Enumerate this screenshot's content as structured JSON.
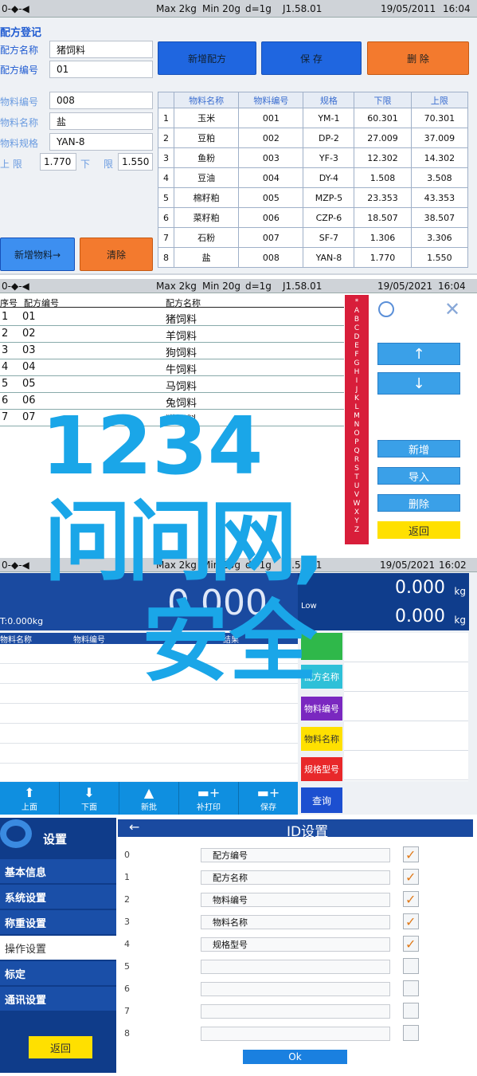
{
  "panel1": {
    "status": {
      "left": "0-◆-◀",
      "max": "Max 2kg",
      "min": "Min 20g",
      "d": "d=1g",
      "ver": "J1.58.01",
      "date": "19/05/2011",
      "time": "16:04"
    },
    "title": "配方登记",
    "recipe_name_label": "配方名称",
    "recipe_name_value": "猪饲料",
    "recipe_code_label": "配方编号",
    "recipe_code_value": "01",
    "btn_new_recipe": "新增配方",
    "btn_save": "保    存",
    "btn_delete": "删    除",
    "mat_code_label": "物料编号",
    "mat_code_value": "008",
    "mat_name_label": "物料名称",
    "mat_name_value": "盐",
    "mat_spec_label": "物料规格",
    "mat_spec_value": "YAN-8",
    "upper_label": "上    限",
    "upper_value": "1.770",
    "lower_label": "下",
    "limit_label": "限",
    "lower_value": "1.550",
    "btn_add_material": "新增物料→",
    "btn_clear": "清除",
    "table_headers": [
      "",
      "物料名称",
      "物料编号",
      "规格",
      "下限",
      "上限"
    ],
    "table_rows": [
      [
        "1",
        "玉米",
        "001",
        "YM-1",
        "60.301",
        "70.301"
      ],
      [
        "2",
        "豆粕",
        "002",
        "DP-2",
        "27.009",
        "37.009"
      ],
      [
        "3",
        "鱼粉",
        "003",
        "YF-3",
        "12.302",
        "14.302"
      ],
      [
        "4",
        "豆油",
        "004",
        "DY-4",
        "1.508",
        "3.508"
      ],
      [
        "5",
        "棉籽粕",
        "005",
        "MZP-5",
        "23.353",
        "43.353"
      ],
      [
        "6",
        "菜籽粕",
        "006",
        "CZP-6",
        "18.507",
        "38.507"
      ],
      [
        "7",
        "石粉",
        "007",
        "SF-7",
        "1.306",
        "3.306"
      ],
      [
        "8",
        "盐",
        "008",
        "YAN-8",
        "1.770",
        "1.550"
      ]
    ]
  },
  "panel2": {
    "status": {
      "left": "0-◆-◀",
      "max": "Max 2kg",
      "min": "Min 20g",
      "d": "d=1g",
      "ver": "J1.58.01",
      "date": "19/05/2021",
      "time": "16:04"
    },
    "col_seq": "序号",
    "col_code": "配方编号",
    "col_name": "配方名称",
    "rows": [
      [
        "1",
        "01",
        "猪饲料"
      ],
      [
        "2",
        "02",
        "羊饲料"
      ],
      [
        "3",
        "03",
        "狗饲料"
      ],
      [
        "4",
        "04",
        "牛饲料"
      ],
      [
        "5",
        "05",
        "马饲料"
      ],
      [
        "6",
        "06",
        "兔饲料"
      ],
      [
        "7",
        "07",
        "猫饲料"
      ]
    ],
    "alphabet": [
      "*",
      "A",
      "B",
      "C",
      "D",
      "E",
      "F",
      "G",
      "H",
      "I",
      "J",
      "K",
      "L",
      "M",
      "N",
      "O",
      "P",
      "Q",
      "R",
      "S",
      "T",
      "U",
      "V",
      "W",
      "X",
      "Y",
      "Z"
    ],
    "btn_up": "↑",
    "btn_down": "↓",
    "btn_add": "新增",
    "btn_import": "导入",
    "btn_delete": "删除",
    "btn_back": "返回"
  },
  "watermark": {
    "line1": "1234",
    "line2": "问问网,",
    "line3": "安全"
  },
  "panel3": {
    "status": {
      "left": "0-◆-◀",
      "max": "Max 2kg",
      "min": "Min 20g",
      "d": "d=1g",
      "ver": "J1.58.01",
      "date": "19/05/2021",
      "time": "16:02"
    },
    "big_weight": "0.000",
    "weight_hi": "0.000",
    "unit_hi": "kg",
    "low_label": "Low",
    "weight_lo": "0.000",
    "unit_lo": "kg",
    "total": "T:0.000kg",
    "col_mat_name": "物料名称",
    "col_mat_code": "物料编号",
    "col_result": "结果",
    "side_recipe_name": "配方名称",
    "side_mat_code": "物料编号",
    "side_mat_name": "物料名称",
    "side_spec": "规格型号",
    "side_query": "查询",
    "tb_upload": "上面",
    "tb_download": "下面",
    "tb_new": "新批",
    "tb_print": "补打印",
    "tb_save": "保存"
  },
  "panel4": {
    "settings_title": "设置",
    "menu": [
      "基本信息",
      "系统设置",
      "称重设置",
      "操作设置",
      "标定",
      "通讯设置"
    ],
    "btn_back": "返回",
    "header_back": "←",
    "header_title": "ID设置",
    "rows": [
      {
        "n": "0",
        "label": "配方编号",
        "checked": true
      },
      {
        "n": "1",
        "label": "配方名称",
        "checked": true
      },
      {
        "n": "2",
        "label": "物料编号",
        "checked": true
      },
      {
        "n": "3",
        "label": "物料名称",
        "checked": true
      },
      {
        "n": "4",
        "label": "规格型号",
        "checked": true
      },
      {
        "n": "5",
        "label": "",
        "checked": false
      },
      {
        "n": "6",
        "label": "",
        "checked": false
      },
      {
        "n": "7",
        "label": "",
        "checked": false
      },
      {
        "n": "8",
        "label": "",
        "checked": false
      }
    ],
    "btn_ok": "Ok"
  }
}
